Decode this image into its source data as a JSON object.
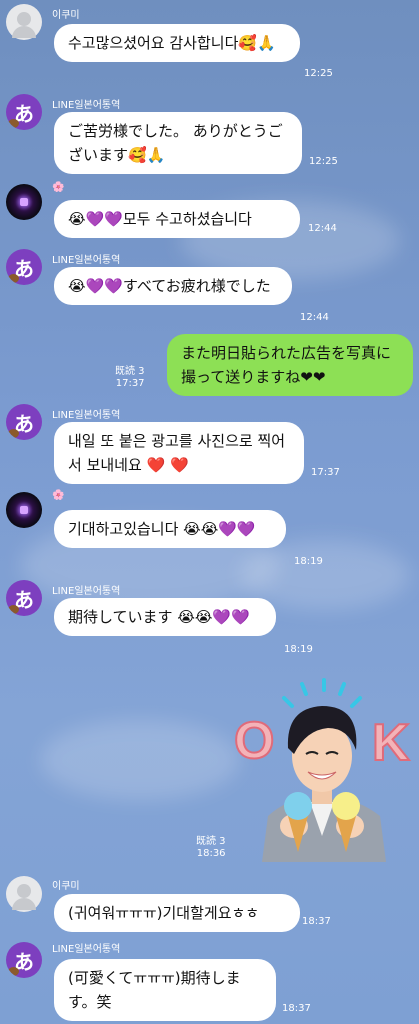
{
  "messages": [
    {
      "sender": "이쿠미",
      "text": "수고많으셨어요 감사합니다🥰🙏",
      "time": "12:25"
    },
    {
      "sender": "LINE일본어통역",
      "text": "ご苦労様でした。 ありがとうございます🥰🙏",
      "time": "12:25"
    },
    {
      "sender": "🌸",
      "text": "😭💜💜모두 수고하셨습니다",
      "time": "12:44"
    },
    {
      "sender": "LINE일본어통역",
      "text": "😭💜💜すべてお疲れ様でした",
      "time": "12:44"
    },
    {
      "sender": "me",
      "text": "また明日貼られた広告を写真に撮って送りますね❤❤",
      "read": "既読 3",
      "time": "17:37"
    },
    {
      "sender": "LINE일본어통역",
      "text": "내일 또 붙은 광고를 사진으로 찍어서 보내네요 ❤️ ❤️",
      "time": "17:37"
    },
    {
      "sender": "🌸",
      "text": "기대하고있습니다 😭😭💜💜",
      "time": "18:19"
    },
    {
      "sender": "LINE일본어통역",
      "text": "期待しています 😭😭💜💜",
      "time": "18:19"
    },
    {
      "sender": "me",
      "sticker_text": "OK",
      "read": "既読 3",
      "time": "18:36"
    },
    {
      "sender": "이쿠미",
      "text": "(귀여워ㅠㅠㅠ)기대할게요ㅎㅎ",
      "time": "18:37"
    },
    {
      "sender": "LINE일본어통역",
      "text": "(可愛くてㅠㅠㅠ)期待します。笑",
      "time": "18:37"
    }
  ],
  "avatar_glyph": "あ",
  "colors": {
    "my_bubble": "#8de055",
    "their_bubble": "#ffffff",
    "background": "#7b9bd0"
  }
}
